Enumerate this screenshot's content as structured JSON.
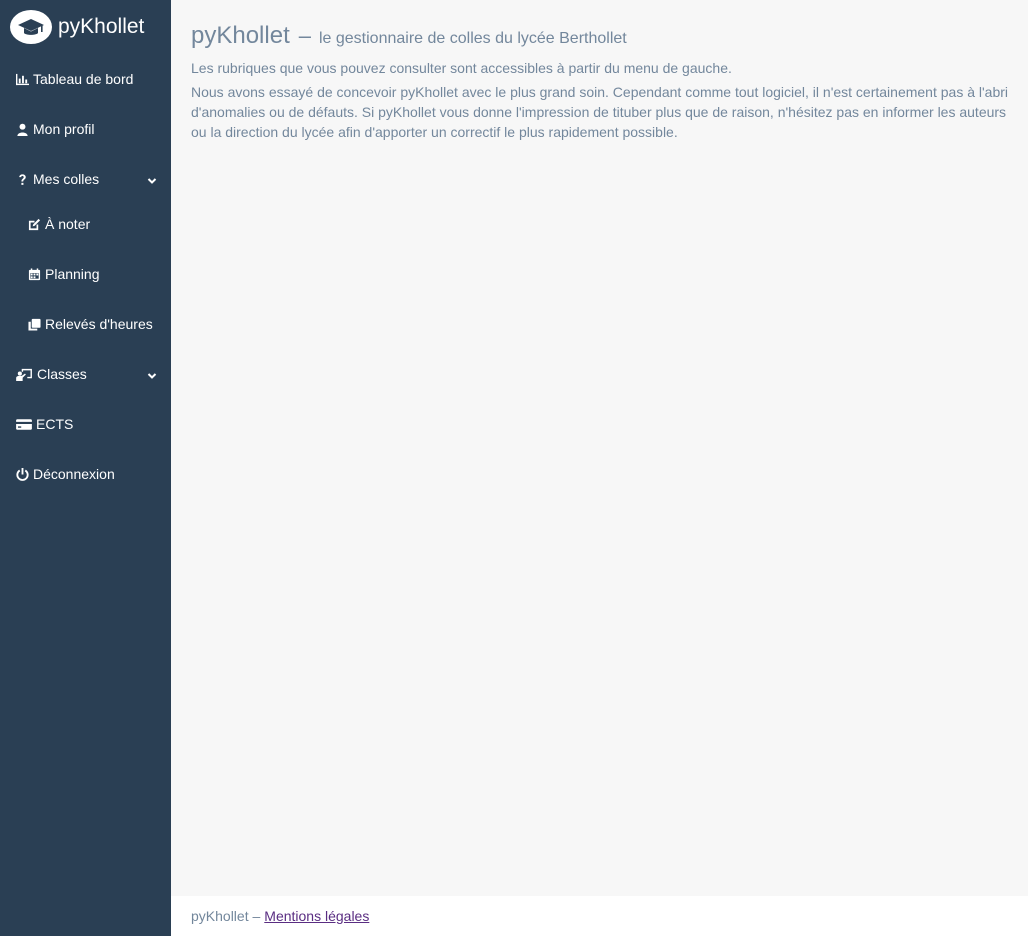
{
  "brand": {
    "name": "pyKhollet",
    "logo_icon": "graduation-cap-icon"
  },
  "sidebar": {
    "items": [
      {
        "label": "Tableau de bord",
        "icon": "bar-chart-icon"
      },
      {
        "label": "Mon profil",
        "icon": "user-icon"
      },
      {
        "label": "Mes colles",
        "icon": "question-icon"
      },
      {
        "label": "À noter",
        "icon": "edit-icon"
      },
      {
        "label": "Planning",
        "icon": "calendar-icon"
      },
      {
        "label": "Relevés d'heures",
        "icon": "copy-icon"
      },
      {
        "label": "Classes",
        "icon": "chalkboard-teacher-icon"
      },
      {
        "label": "ECTS",
        "icon": "credit-card-icon"
      },
      {
        "label": "Déconnexion",
        "icon": "power-icon"
      }
    ]
  },
  "main": {
    "title": "pyKhollet",
    "dash": "–",
    "subtitle": "le gestionnaire de colles du lycée Berthollet",
    "intro": "Les rubriques que vous pouvez consulter sont accessibles à partir du menu de gauche.",
    "notice": "Nous avons essayé de concevoir pyKhollet avec le plus grand soin. Cependant comme tout logiciel, il n'est certainement pas à l'abri d'anomalies ou de défauts. Si pyKhollet vous donne l'impression de tituber plus que de raison, n'hésitez pas en informer les auteurs ou la direction du lycée afin d'apporter un correctif le plus rapidement possible."
  },
  "footer": {
    "text": "pyKhollet –",
    "link_label": "Mentions légales"
  },
  "colors": {
    "sidebar_bg": "#2a3f54",
    "text_muted": "#73879c",
    "link": "#5a2d82",
    "content_bg": "#f7f7f7"
  }
}
